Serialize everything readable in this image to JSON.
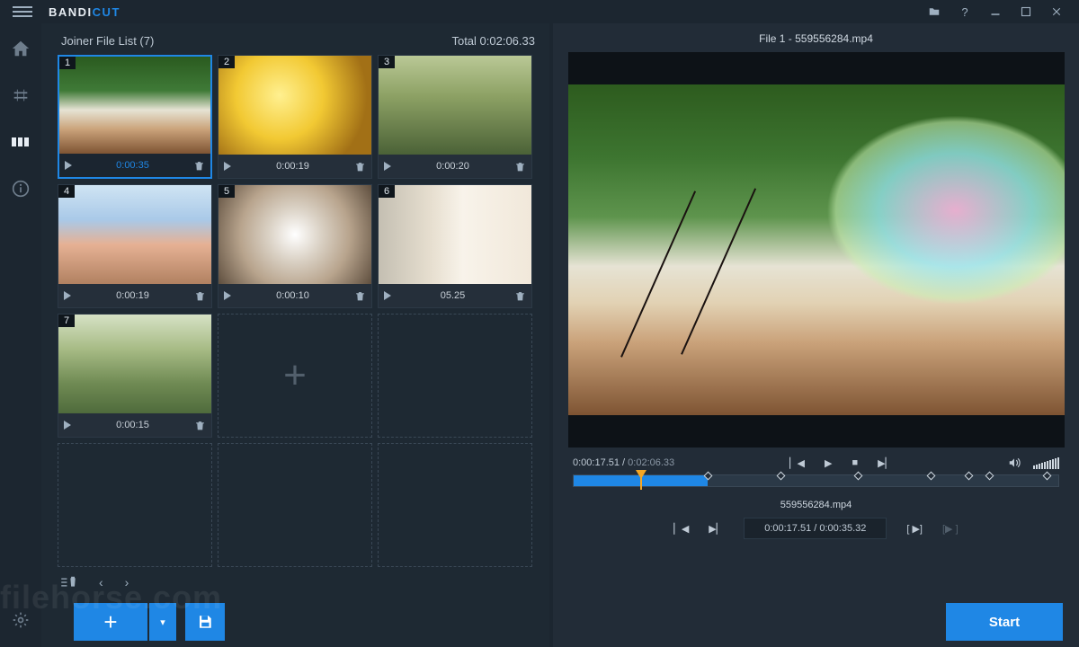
{
  "app": {
    "brand_a": "BANDI",
    "brand_b": "CUT"
  },
  "titlebar": {
    "help": "?"
  },
  "left": {
    "header_label": "Joiner File List (7)",
    "total_label": "Total 0:02:06.33"
  },
  "clips": [
    {
      "n": "1",
      "dur": "0:00:35",
      "sel": true
    },
    {
      "n": "2",
      "dur": "0:00:19",
      "sel": false
    },
    {
      "n": "3",
      "dur": "0:00:20",
      "sel": false
    },
    {
      "n": "4",
      "dur": "0:00:19",
      "sel": false
    },
    {
      "n": "5",
      "dur": "0:00:10",
      "sel": false
    },
    {
      "n": "6",
      "dur": "05.25",
      "sel": false
    },
    {
      "n": "7",
      "dur": "0:00:15",
      "sel": false
    }
  ],
  "preview": {
    "title": "File 1 - 559556284.mp4",
    "time_current": "0:00:17.51",
    "time_total": "0:02:06.33",
    "clip_name": "559556284.mp4",
    "seg_time": "0:00:17.51 / 0:00:35.32",
    "mark1": "[ ▶]",
    "mark2": "[▶ ]"
  },
  "footer": {
    "start": "Start"
  },
  "watermark": "filehorse.com"
}
